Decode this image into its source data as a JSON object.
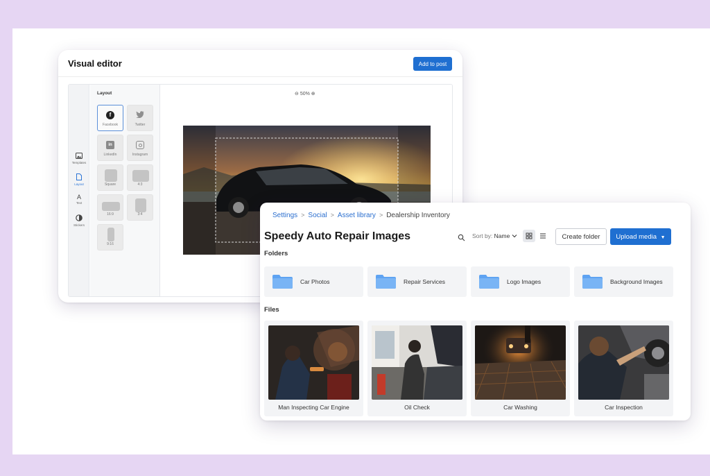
{
  "editor": {
    "title": "Visual editor",
    "add_to_post": "Add to post",
    "rail": [
      {
        "icon": "image-icon",
        "label": "Templates"
      },
      {
        "icon": "document-icon",
        "label": "Layout"
      },
      {
        "icon": "text-icon",
        "label": "Text"
      },
      {
        "icon": "sticker-icon",
        "label": "Stickers"
      }
    ],
    "layout_heading": "Layout",
    "tiles": [
      {
        "label": "Facebook",
        "icon": "facebook-icon"
      },
      {
        "label": "Twitter",
        "icon": "twitter-icon"
      },
      {
        "label": "LinkedIn",
        "icon": "linkedin-icon"
      },
      {
        "label": "Instagram",
        "icon": "instagram-icon"
      },
      {
        "label": "Square"
      },
      {
        "label": "4:3"
      },
      {
        "label": "16:9"
      },
      {
        "label": "3:4"
      },
      {
        "label": "9:16"
      }
    ],
    "zoom": "50%"
  },
  "library": {
    "breadcrumb": [
      "Settings",
      "Social",
      "Asset library",
      "Dealership Inventory"
    ],
    "title": "Speedy Auto Repair Images",
    "sort_label": "Sort by:",
    "sort_value": "Name",
    "create_folder": "Create folder",
    "upload_media": "Upload media",
    "folders_heading": "Folders",
    "folders": [
      "Car Photos",
      "Repair Services",
      "Logo Images",
      "Background Images"
    ],
    "files_heading": "Files",
    "files": [
      "Man Inspecting Car Engine",
      "Oil Check",
      "Car Washing",
      "Car Inspection"
    ]
  },
  "colors": {
    "accent": "#1f6fd1",
    "background": "#e6d6f3",
    "folder": "#5ea3f2"
  }
}
